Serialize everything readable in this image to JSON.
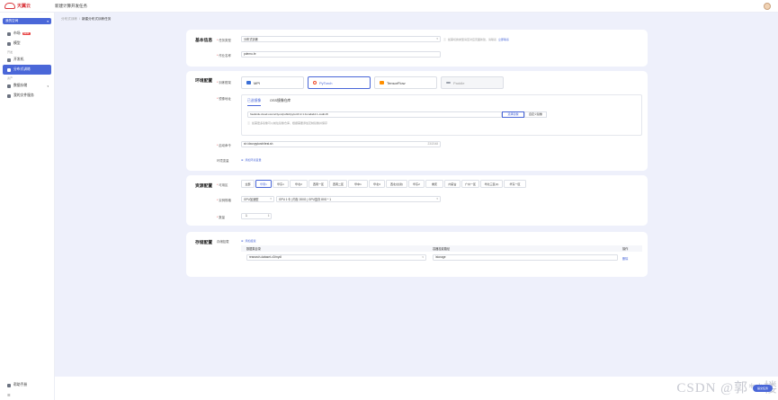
{
  "app": {
    "logo_text": "天翼云",
    "title": "新建计算开发任务"
  },
  "sidebar": {
    "workspace": "我的空间",
    "items": [
      {
        "label": "市场",
        "badge": "NEW"
      },
      {
        "label": "模型"
      }
    ],
    "section_dev": "开发",
    "dev_items": [
      {
        "label": "开发机"
      },
      {
        "label": "分布式训练"
      }
    ],
    "section_asset": "资产",
    "asset_items": [
      {
        "label": "数据存储"
      },
      {
        "label": "我的文件服务"
      }
    ],
    "bottom_item": "帮助手册"
  },
  "breadcrumb": {
    "parent": "分布式训练",
    "sep": "/",
    "current": "新建分布式训练任务"
  },
  "basic": {
    "title": "基本信息",
    "task_type_label": "任务类型",
    "task_type_value": "分布式训练",
    "hint_text": "如需切换类型请至对应页面新建，请联系",
    "hint_link": "立即联系",
    "name_label": "作业名称",
    "name_value": "pdemo-fe"
  },
  "env": {
    "title": "环境配置",
    "framework_label": "训练框架",
    "frameworks": [
      {
        "label": "MPI",
        "state": "normal",
        "color": "#3b6fd6"
      },
      {
        "label": "PyTorch",
        "state": "selected",
        "color": "#ee4c2c"
      },
      {
        "label": "TensorFlow",
        "state": "normal",
        "color": "#ff8f00"
      },
      {
        "label": "Paddle",
        "state": "disabled",
        "color": "#9aa0ab"
      }
    ],
    "image_label": "镜像地址",
    "image_tabs": [
      "已选镜像",
      "OSS镜像仓库"
    ],
    "image_value": "hsabcdu.cloud.ocom/ctyun/public/pytorch:2.1.0-cuda12.1-cudnn8",
    "image_btns": [
      "选择镜像",
      "自定义镜像"
    ],
    "image_hint": "如需更多镜像可以前往镜像仓库，根据需要添加定制镜像并保存",
    "command_label": "启动命令",
    "command_value": "sh /dxcxpytorch/test.sh",
    "command_count": "23/2048",
    "envvar_label": "环境变量",
    "envvar_link": "添加环境变量"
  },
  "resource": {
    "title": "资源配置",
    "spec_label": "可用区",
    "specs": [
      "全部",
      "华南1",
      "华东1",
      "华北2",
      "西南一区",
      "西南二区",
      "华中1",
      "华北3",
      "西北(甘肃)",
      "华东2",
      "重庆",
      "内蒙古",
      "广州一区",
      "华北三区(2)",
      "华东一区"
    ],
    "selected_spec_index": 1,
    "flavor_label": "实例规格",
    "flavor_type": "GPU加速型",
    "flavor_value": "GPU 1卡 | 内存 200G | GPU显存 80G * 1",
    "count_label": "数量",
    "count_value": "1"
  },
  "storage": {
    "title": "存储配置",
    "mount_label": "存储挂载",
    "add_link": "添加挂载",
    "columns": [
      "数据集目录",
      "容器挂载路径",
      "操作"
    ],
    "rows": [
      {
        "source": "research-dataset-v2/mydl",
        "path": "/storage",
        "action": "删除"
      }
    ]
  },
  "bottom": {
    "fab": "提交任务",
    "watermark": "CSDN @郭**楼"
  }
}
